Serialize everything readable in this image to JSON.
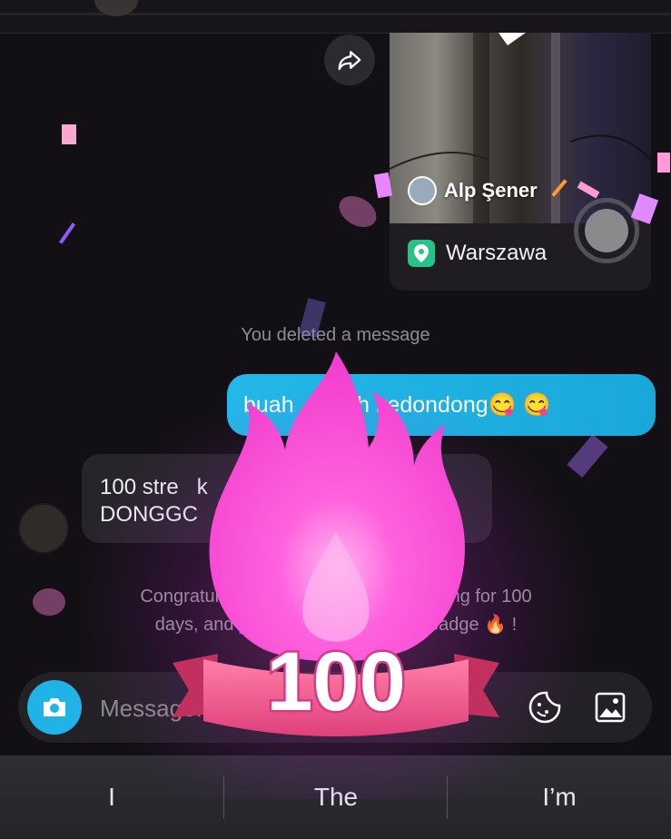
{
  "video_card": {
    "author": "Alp Şener",
    "location": "Warszawa"
  },
  "system_note": "You deleted a message",
  "messages": {
    "outgoing_text": "buah        ah kedondong😋 😋",
    "incoming_line1": "100 stre   k",
    "incoming_line2": "DONGGC"
  },
  "streak_note": {
    "line1": "Congratulat                                        oing for 100",
    "line2": "days, and yo                               k badge 🔥 !"
  },
  "streak_badge": {
    "number": "100"
  },
  "composer": {
    "placeholder": "Message..."
  },
  "keyboard": {
    "suggestions": [
      "I",
      "The",
      "I’m"
    ]
  },
  "colors": {
    "accent": "#1fb3e6",
    "flame": "#ff4fd8",
    "background": "#121014"
  },
  "icons": [
    "share-icon",
    "location-pin-icon",
    "camera-icon",
    "sticker-icon",
    "image-icon",
    "flame-icon"
  ]
}
